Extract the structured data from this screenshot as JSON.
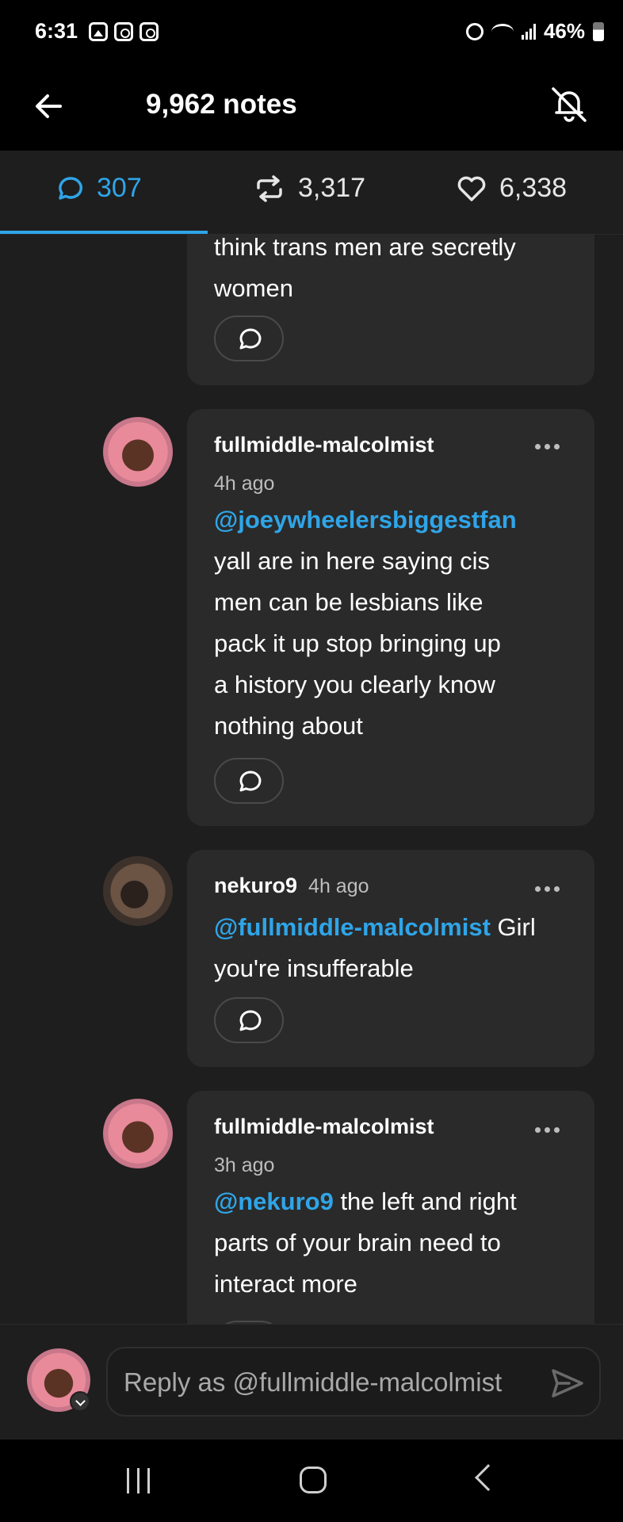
{
  "status_bar": {
    "time": "6:31",
    "battery": "46%",
    "icons_left": [
      "gallery-icon",
      "instagram-icon",
      "instagram-icon"
    ],
    "icons_right": [
      "alarm-icon",
      "wifi-icon",
      "signal-icon",
      "battery-icon"
    ]
  },
  "header": {
    "title": "9,962 notes",
    "back_icon": "arrow-left-icon",
    "mute_icon": "bell-off-icon"
  },
  "tabs": [
    {
      "icon": "comment-icon",
      "count": "307",
      "active": true
    },
    {
      "icon": "reblog-icon",
      "count": "3,317",
      "active": false
    },
    {
      "icon": "heart-icon",
      "count": "6,338",
      "active": false
    }
  ],
  "comments": [
    {
      "text_lines": [
        "think trans men are secretly",
        "women"
      ]
    },
    {
      "username": "fullmiddle-malcolmist",
      "time": "4h ago",
      "mention": "@joeywheelersbiggestfan",
      "text_lines": [
        "yall are in here saying cis",
        "men can be lesbians like",
        "pack it up stop bringing up",
        "a history you clearly know",
        "nothing about"
      ]
    },
    {
      "username": "nekuro9",
      "time": "4h ago",
      "mention": "@fullmiddle-malcolmist",
      "text_first_tail": " Girl",
      "text_lines": [
        "you're insufferable"
      ]
    },
    {
      "username": "fullmiddle-malcolmist",
      "time": "3h ago",
      "mention": "@nekuro9",
      "text_first_tail": " the left and right",
      "text_lines": [
        "parts of your brain need to",
        "interact more"
      ]
    }
  ],
  "composer": {
    "placeholder": "Reply as @fullmiddle-malcolmist",
    "send_icon": "send-icon"
  },
  "colors": {
    "accent": "#2fa5e8",
    "background": "#1e1e1e",
    "card": "#2a2a2a"
  }
}
